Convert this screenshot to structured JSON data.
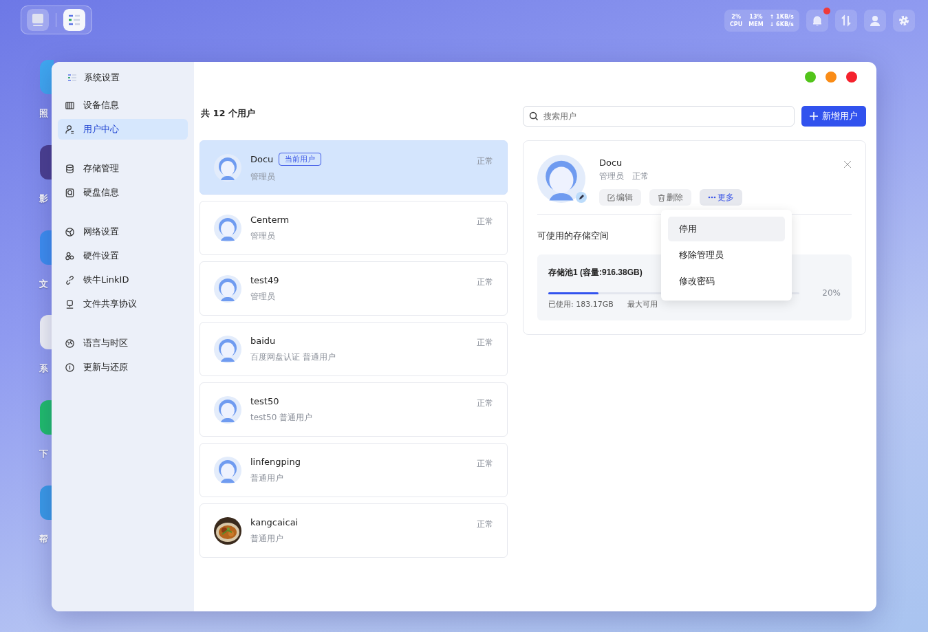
{
  "desktop_icons": [
    {
      "label": "照",
      "color": "#3fa7f0"
    },
    {
      "label": "影",
      "color": "#4b3f8f"
    },
    {
      "label": "文",
      "color": "#3d8ef0"
    },
    {
      "label": "系",
      "color": "#f2f4f8"
    },
    {
      "label": "下",
      "color": "#1fbf6a"
    },
    {
      "label": "帮",
      "color": "#3a9be8"
    }
  ],
  "top_stats": [
    {
      "value": "2%",
      "label": "CPU"
    },
    {
      "value": "13%",
      "label": "MEM"
    },
    {
      "value": "↑ 1KB/s",
      "label": "↓ 6KB/s"
    }
  ],
  "window": {
    "controls": [
      {
        "color": "#52c41a"
      },
      {
        "color": "#fa8c16"
      },
      {
        "color": "#f5222d"
      }
    ]
  },
  "sidebar": {
    "title": "系统设置",
    "groups": [
      [
        {
          "label": "设备信息",
          "selected": false
        },
        {
          "label": "用户中心",
          "selected": true
        }
      ],
      [
        {
          "label": "存储管理",
          "selected": false
        },
        {
          "label": "硬盘信息",
          "selected": false
        }
      ],
      [
        {
          "label": "网络设置",
          "selected": false
        },
        {
          "label": "硬件设置",
          "selected": false
        },
        {
          "label": "铁牛LinkID",
          "selected": false
        },
        {
          "label": "文件共享协议",
          "selected": false
        }
      ],
      [
        {
          "label": "语言与时区",
          "selected": false
        },
        {
          "label": "更新与还原",
          "selected": false
        }
      ]
    ]
  },
  "user_list": {
    "count_label": "共 12 个用户",
    "users": [
      {
        "name": "Docu",
        "badge": "当前用户",
        "role": "管理员",
        "status": "正常",
        "selected": true,
        "kind": "avatar"
      },
      {
        "name": "Centerm",
        "role": "管理员",
        "status": "正常",
        "selected": false,
        "kind": "avatar"
      },
      {
        "name": "test49",
        "role": "管理员",
        "status": "正常",
        "selected": false,
        "kind": "avatar"
      },
      {
        "name": "baidu",
        "role": "百度网盘认证 普通用户",
        "status": "正常",
        "selected": false,
        "kind": "avatar"
      },
      {
        "name": "test50",
        "role": "test50 普通用户",
        "status": "正常",
        "selected": false,
        "kind": "avatar"
      },
      {
        "name": "linfengping",
        "role": "普通用户",
        "status": "正常",
        "selected": false,
        "kind": "avatar"
      },
      {
        "name": "kangcaicai",
        "role": "普通用户",
        "status": "正常",
        "selected": false,
        "kind": "picture"
      }
    ]
  },
  "search": {
    "placeholder": "搜索用户"
  },
  "add_button": "新增用户",
  "detail": {
    "name": "Docu",
    "role": "管理员",
    "status": "正常",
    "actions": [
      {
        "label": "编辑"
      },
      {
        "label": "删除"
      },
      {
        "label": "更多"
      }
    ],
    "storage_heading": "可使用的存储空间",
    "pool": {
      "title": "存储池1 (容量:916.38GB)",
      "level": 0.2,
      "percent": "20%",
      "used": "已使用: 183.17GB",
      "max": "最大可用"
    },
    "menu": [
      {
        "label": "停用",
        "highlighted": true
      },
      {
        "label": "移除管理员",
        "highlighted": false
      },
      {
        "label": "修改密码",
        "highlighted": false
      }
    ]
  }
}
